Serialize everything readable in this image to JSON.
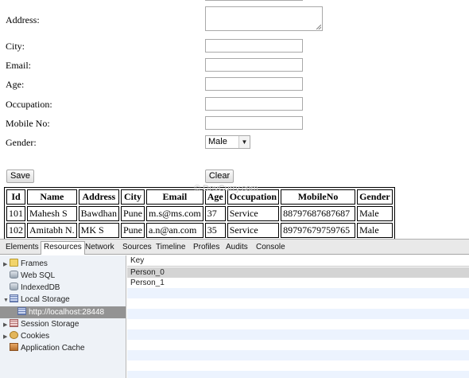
{
  "form": {
    "address_label": "Address:",
    "city_label": "City:",
    "email_label": "Email:",
    "age_label": "Age:",
    "occupation_label": "Occupation:",
    "mobile_label": "Mobile No:",
    "gender_label": "Gender:",
    "gender_selected": "Male",
    "save_label": "Save",
    "clear_label": "Clear"
  },
  "watermark": "© DevCurry.com",
  "table": {
    "headers": [
      "Id",
      "Name",
      "Address",
      "City",
      "Email",
      "Age",
      "Occupation",
      "MobileNo",
      "Gender"
    ],
    "rows": [
      [
        "101",
        "Mahesh S",
        "Bawdhan",
        "Pune",
        "m.s@ms.com",
        "37",
        "Service",
        "88797687687687",
        "Male"
      ],
      [
        "102",
        "Amitabh N.",
        "MK S",
        "Pune",
        "a.n@an.com",
        "35",
        "Service",
        "89797679759765",
        "Male"
      ]
    ]
  },
  "devtools": {
    "tabs": [
      "Elements",
      "Resources",
      "Network",
      "Sources",
      "Timeline",
      "Profiles",
      "Audits",
      "Console"
    ],
    "active_tab": "Resources",
    "tree": {
      "frames": "Frames",
      "web_sql": "Web SQL",
      "indexed_db": "IndexedDB",
      "local_storage": "Local Storage",
      "local_storage_origin": "http://localhost:28448",
      "session_storage": "Session Storage",
      "cookies": "Cookies",
      "application_cache": "Application Cache"
    },
    "grid": {
      "key_header": "Key",
      "keys": [
        "Person_0",
        "Person_1"
      ]
    }
  }
}
